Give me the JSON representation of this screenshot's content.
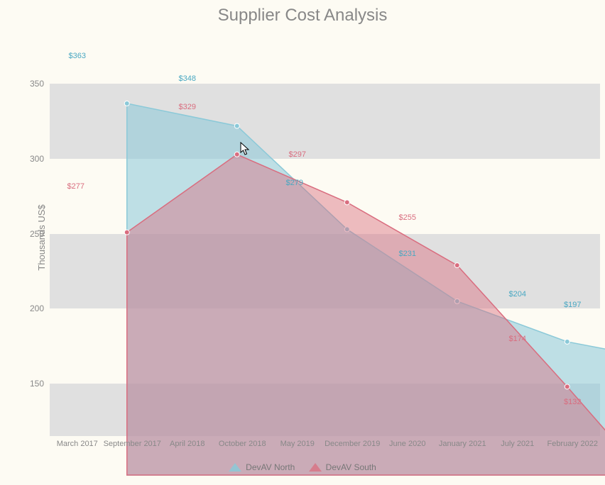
{
  "title": "Supplier Cost Analysis",
  "ylabel": "Thousands US$",
  "chart_data": {
    "type": "area",
    "categories": [
      "March 2017",
      "September 2017",
      "April 2018",
      "October 2018",
      "May 2019",
      "December 2019",
      "June 2020",
      "January 2021",
      "July 2021",
      "February 2022"
    ],
    "series": [
      {
        "name": "DevAV North",
        "color": "#8bc9d8",
        "fill": "rgba(139,201,216,0.55)",
        "values": [
          363,
          null,
          348,
          null,
          279,
          null,
          231,
          null,
          204,
          197
        ]
      },
      {
        "name": "DevAV South",
        "color": "#d96d7f",
        "fill": "rgba(217,109,127,0.45)",
        "values": [
          277,
          null,
          329,
          null,
          297,
          null,
          255,
          null,
          174,
          132
        ]
      }
    ],
    "ylim": [
      115,
      380
    ],
    "yticks": [
      150,
      200,
      250,
      300,
      350
    ]
  },
  "legend": {
    "north": "DevAV North",
    "south": "DevAV South"
  },
  "labels": {
    "north": [
      "$363",
      "$348",
      "$279",
      "$231",
      "$204",
      "$197"
    ],
    "south": [
      "$277",
      "$329",
      "$297",
      "$255",
      "$174",
      "$132"
    ]
  }
}
